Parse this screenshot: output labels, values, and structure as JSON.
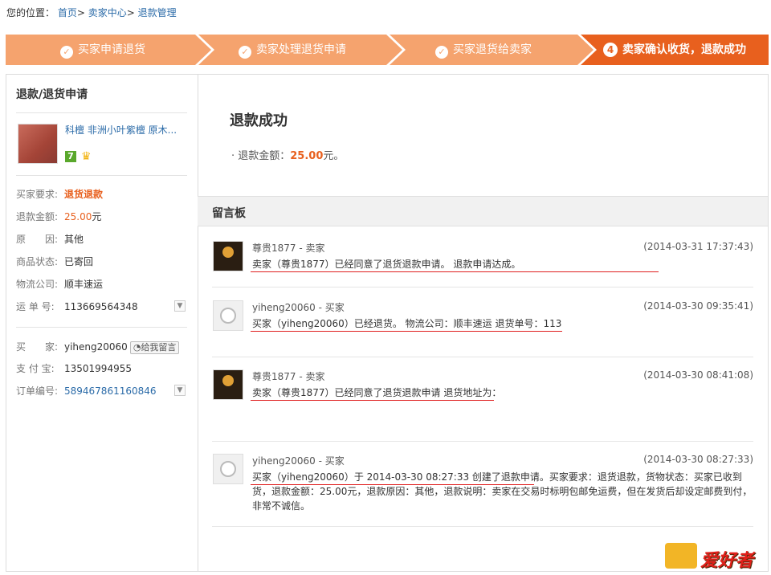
{
  "breadcrumb": {
    "prefix": "您的位置：",
    "items": [
      "首页",
      "卖家中心",
      "退款管理"
    ],
    "sep": ">"
  },
  "steps": [
    {
      "label": "买家申请退货",
      "state": "done",
      "color": "#f5a36e"
    },
    {
      "label": "卖家处理退货申请",
      "state": "done",
      "color": "#f5a36e"
    },
    {
      "label": "买家退货给卖家",
      "state": "done",
      "color": "#f5a36e"
    },
    {
      "num": "4",
      "label": "卖家确认收货，退款成功",
      "state": "current",
      "color": "#e8601e"
    }
  ],
  "left": {
    "title": "退款/退货申请",
    "product_name": "科檀 非洲小叶紫檀 原木...",
    "badge": "7",
    "info": [
      {
        "label": "买家要求:",
        "value": "退货退款"
      },
      {
        "label": "退款金额:",
        "value": "25.00",
        "unit": "元"
      },
      {
        "label": "原　　因:",
        "value": "其他"
      },
      {
        "label": "商品状态:",
        "value": "已寄回"
      },
      {
        "label": "物流公司:",
        "value": "顺丰速运"
      },
      {
        "label": "运 单 号:",
        "value": "113669564348"
      }
    ],
    "buyer": [
      {
        "label": "买　　家:",
        "value": "yiheng20060",
        "button": "给我留言"
      },
      {
        "label": "支 付 宝:",
        "value": "13501994955"
      },
      {
        "label": "订单编号:",
        "value": "589467861160846"
      }
    ]
  },
  "result": {
    "title": "退款成功",
    "amount_label": "· 退款金额：",
    "amount": "25.00",
    "unit": "元。"
  },
  "board_title": "留言板",
  "messages": [
    {
      "who": "尊贵1877 - 卖家",
      "time": "(2014-03-31 17:37:43)",
      "role": "seller",
      "text": "卖家（尊贵1877）已经同意了退货退款申请。 退款申请达成。"
    },
    {
      "who": "yiheng20060 - 买家",
      "time": "(2014-03-30 09:35:41)",
      "role": "buyer",
      "text": "买家（yiheng20060）已经退货。 物流公司：顺丰速运 退货单号：113"
    },
    {
      "who": "尊贵1877 - 卖家",
      "time": "(2014-03-30 08:41:08)",
      "role": "seller",
      "text": "卖家（尊贵1877）已经同意了退货退款申请 退货地址为："
    },
    {
      "who": "yiheng20060 - 买家",
      "time": "(2014-03-30 08:27:33)",
      "role": "buyer",
      "text": "买家（yiheng20060）于 2014-03-30 08:27:33 创建了退款申请。买家要求：退货退款，货物状态：买家已收到货，退款金额：25.00元，退款原因：其他，退款说明：卖家在交易时标明包邮免运费，但在发货后却设定邮费到付，非常不诚信。"
    }
  ],
  "watermark": "爱好者"
}
